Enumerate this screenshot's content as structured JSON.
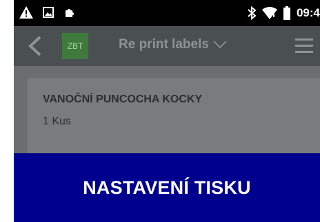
{
  "status_bar": {
    "time": "09:4",
    "icons": [
      "warning-icon",
      "image-icon",
      "puzzle-icon",
      "bluetooth-icon",
      "wifi-icon",
      "battery-icon"
    ]
  },
  "app_bar": {
    "logo_text": "ZBT",
    "title": "Re print labels",
    "icons": [
      "back-arrow-icon",
      "chevron-down-icon",
      "menu-icon"
    ]
  },
  "product": {
    "name": "VANOČNÍ PUNCOCHA KOCKY",
    "quantity": "1 Kus"
  },
  "dialog": {
    "title": "NASTAVENÍ TISKU"
  },
  "colors": {
    "status_bar_bg": "#000000",
    "app_bar_bg": "#4a4f52",
    "dim_overlay_bg": "#6b6d6e",
    "dialog_bg": "#00008f",
    "logo_bg": "#3f7a3c"
  }
}
